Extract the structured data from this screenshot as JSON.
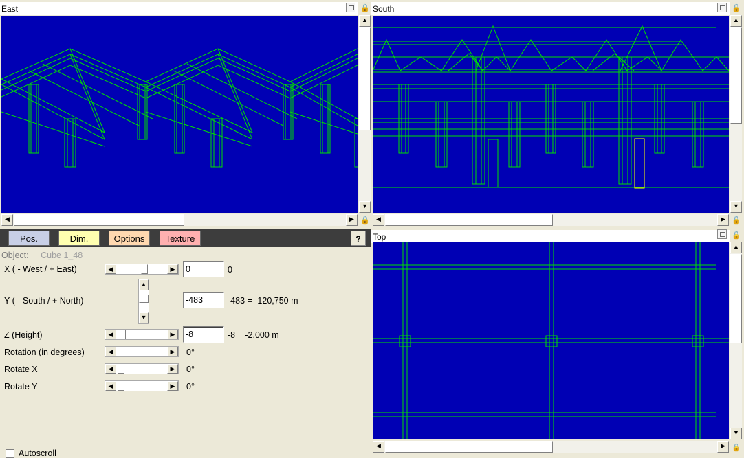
{
  "views": {
    "east": {
      "title": "East"
    },
    "south": {
      "title": "South"
    },
    "top": {
      "title": "Top"
    }
  },
  "tabs": [
    {
      "label": "Pos.",
      "color": "#c8cfe6"
    },
    {
      "label": "Dim.",
      "color": "#ffffb0"
    },
    {
      "label": "Options",
      "color": "#ffd8b0"
    },
    {
      "label": "Texture",
      "color": "#ffb0b0"
    }
  ],
  "help_icon": "?",
  "object": {
    "label": "Object:",
    "name": "Cube 1_48"
  },
  "fields": {
    "x": {
      "label": "X ( - West / + East)",
      "value": "0",
      "result": "0"
    },
    "y": {
      "label": "Y ( - South / + North)",
      "value": "-483",
      "result": "-483 = -120,750 m"
    },
    "z": {
      "label": "Z (Height)",
      "value": "-8",
      "result": "-8 = -2,000 m"
    },
    "rotation": {
      "label": "Rotation (in degrees)",
      "result": "0°"
    },
    "rotate_x": {
      "label": "Rotate X",
      "result": "0°"
    },
    "rotate_y": {
      "label": "Rotate Y",
      "result": "0°"
    }
  },
  "autoscroll": {
    "label": "Autoscroll",
    "checked": false
  },
  "colors": {
    "viewport_bg": "#0000b4",
    "wire": "#00e000",
    "selected": "#ffff00"
  }
}
